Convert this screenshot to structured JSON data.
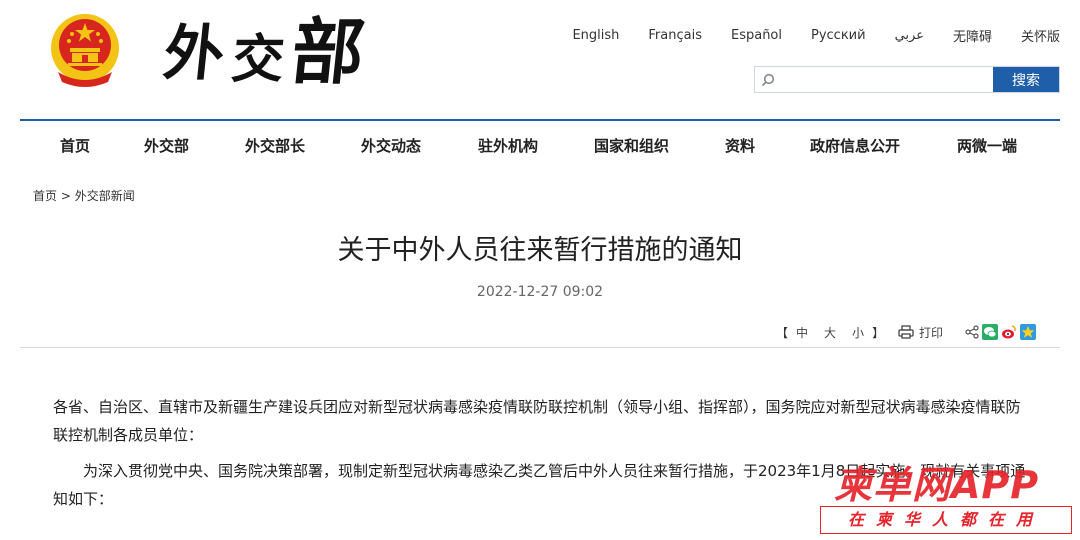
{
  "header": {
    "logo_text": "外交部",
    "languages": [
      "English",
      "Français",
      "Español",
      "Русский",
      "عربي",
      "无障碍",
      "关怀版"
    ],
    "search": {
      "placeholder": "",
      "button_label": "搜索"
    }
  },
  "nav": {
    "items": [
      "首页",
      "外交部",
      "外交部长",
      "外交动态",
      "驻外机构",
      "国家和组织",
      "资料",
      "政府信息公开",
      "两微一端"
    ]
  },
  "breadcrumb": {
    "home": "首页",
    "separator": " > ",
    "current": "外交部新闻"
  },
  "article": {
    "title": "关于中外人员往来暂行措施的通知",
    "date": "2022-12-27 09:02",
    "font_size": {
      "open": "【",
      "options": [
        "中",
        "大",
        "小"
      ],
      "close": "】"
    },
    "print_label": "打印",
    "paragraphs": [
      "各省、自治区、直辖市及新疆生产建设兵团应对新型冠状病毒感染疫情联防联控机制（领导小组、指挥部），国务院应对新型冠状病毒感染疫情联防联控机制各成员单位：",
      "为深入贯彻党中央、国务院决策部署，现制定新型冠状病毒感染乙类乙管后中外人员往来暂行措施，于2023年1月8日起实施。现就有关事项通知如下："
    ]
  },
  "watermark": {
    "top": "柬单网APP",
    "bottom": "在柬华人都在用"
  },
  "colors": {
    "accent": "#1f5ea8",
    "watermark_red": "#e5242b",
    "emblem_red": "#d7261e",
    "emblem_gold": "#f3c315"
  },
  "icons": [
    "national-emblem-icon",
    "search-icon",
    "print-icon",
    "share-icon",
    "wechat-icon",
    "weibo-icon",
    "qzone-icon"
  ]
}
